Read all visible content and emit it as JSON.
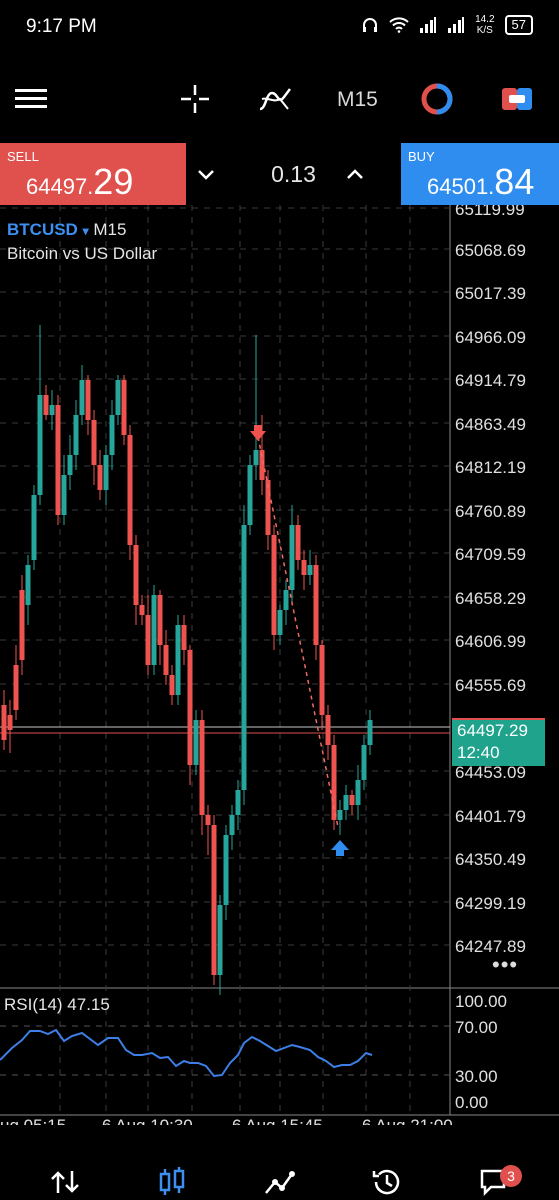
{
  "status_bar": {
    "time": "9:17 PM",
    "speed": "14.2",
    "speed_unit": "K/S",
    "battery": "57"
  },
  "toolbar": {
    "timeframe": "M15"
  },
  "trade": {
    "sell_label": "SELL",
    "sell_price_main": "64497.",
    "sell_price_big": "29",
    "lot": "0.13",
    "buy_label": "BUY",
    "buy_price_main": "64501.",
    "buy_price_big": "84"
  },
  "chart_header": {
    "symbol": "BTCUSD",
    "symbol_arrow": "▾",
    "timeframe": "M15",
    "description": "Bitcoin vs US Dollar"
  },
  "current_price": {
    "price": "64497.29",
    "countdown": "12:40"
  },
  "price_axis": [
    "65119.99",
    "65068.69",
    "65017.39",
    "64966.09",
    "64914.79",
    "64863.49",
    "64812.19",
    "64760.89",
    "64709.59",
    "64658.29",
    "64606.99",
    "64555.69",
    "64453.09",
    "64401.79",
    "64350.49",
    "64299.19",
    "64247.89"
  ],
  "rsi": {
    "label": "RSI(14) 47.15",
    "levels": [
      "100.00",
      "70.00",
      "30.00",
      "0.00"
    ]
  },
  "time_axis": [
    "ug 05:15",
    "6 Aug 10:30",
    "6 Aug 15:45",
    "6 Aug 21:00"
  ],
  "more": "•••",
  "nav": {
    "messages_badge": "3"
  },
  "colors": {
    "bull": "#26a69a",
    "bear": "#ef5350",
    "sell": "#e0504c",
    "buy": "#2f8df0",
    "rsi_line": "#3d7fe6"
  }
}
